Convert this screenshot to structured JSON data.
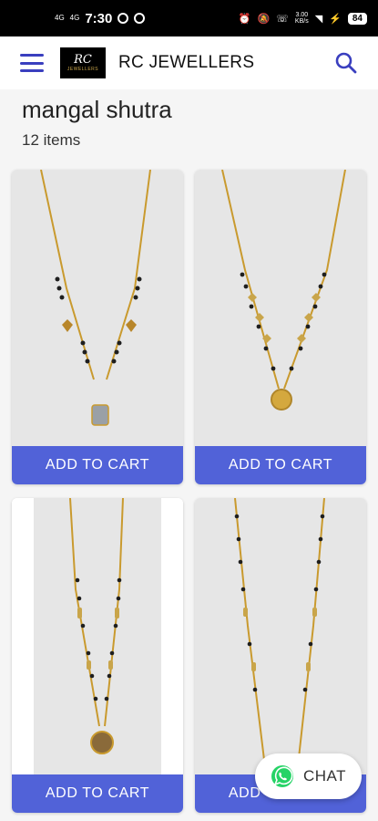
{
  "status_bar": {
    "net1": "4G",
    "net2": "4G",
    "time": "7:30",
    "speed_value": "3.00",
    "speed_unit": "KB/s",
    "battery": "84"
  },
  "app_bar": {
    "logo_main": "RC",
    "logo_sub": "JEWELLERS",
    "brand": "RC JEWELLERS"
  },
  "page": {
    "title": "mangal shutra",
    "count": "12 items"
  },
  "products": [
    {
      "cta": "ADD TO CART"
    },
    {
      "cta": "ADD TO CART"
    },
    {
      "cta": "ADD TO CART"
    },
    {
      "cta": "ADD TO CART"
    }
  ],
  "chat": {
    "label": "CHAT"
  },
  "colors": {
    "accent": "#3a3fbf",
    "button": "#5162d8",
    "whatsapp": "#25d366"
  }
}
